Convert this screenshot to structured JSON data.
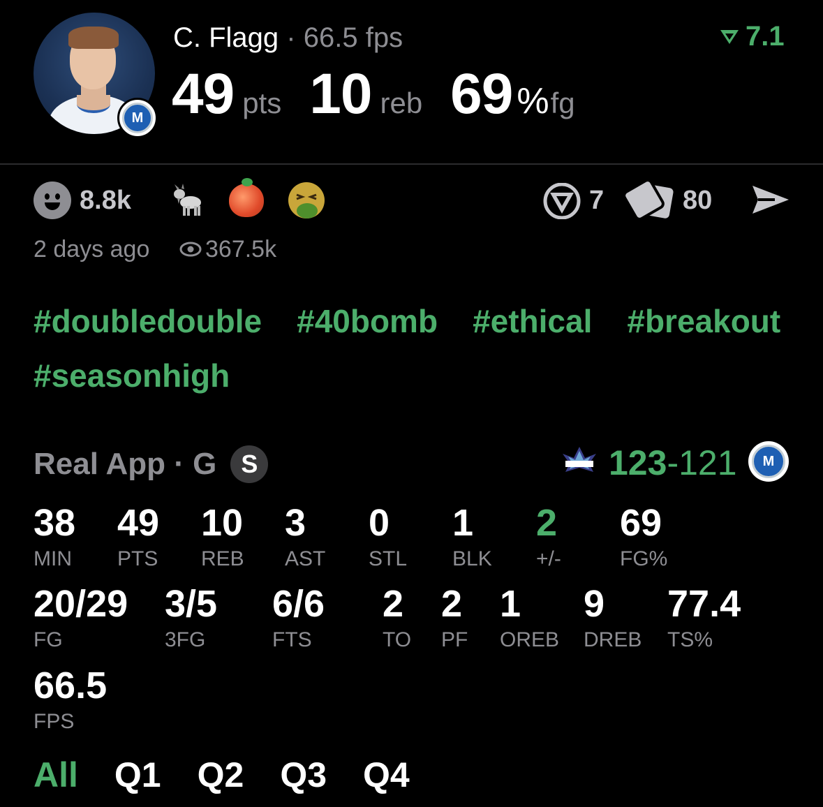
{
  "header": {
    "player_name": "C. Flagg",
    "separator": "·",
    "fps_text": "66.5 fps",
    "rating": "7.1",
    "stats": {
      "pts": "49",
      "pts_unit": "pts",
      "reb": "10",
      "reb_unit": "reb",
      "fg": "69",
      "fg_pct": "%",
      "fg_unit": "fg"
    }
  },
  "reactions": {
    "count": "8.8k",
    "v_count": "7",
    "card_count": "80",
    "time_ago": "2 days ago",
    "views": "367.5k"
  },
  "tags": [
    "#doubledouble",
    "#40bomb",
    "#ethical",
    "#breakout",
    "#seasonhigh"
  ],
  "game": {
    "app_label": "Real App · G",
    "badge": "S",
    "score_win": "123",
    "score_dash": "-",
    "score_lose": "121"
  },
  "stats_row1": [
    {
      "value": "38",
      "label": "MIN"
    },
    {
      "value": "49",
      "label": "PTS"
    },
    {
      "value": "10",
      "label": "REB"
    },
    {
      "value": "3",
      "label": "AST"
    },
    {
      "value": "0",
      "label": "STL"
    },
    {
      "value": "1",
      "label": "BLK"
    },
    {
      "value": "2",
      "label": "+/-"
    },
    {
      "value": "69",
      "label": "FG%"
    }
  ],
  "stats_row2": [
    {
      "value": "20/29",
      "label": "FG"
    },
    {
      "value": "3/5",
      "label": "3FG"
    },
    {
      "value": "6/6",
      "label": "FTS"
    },
    {
      "value": "2",
      "label": "TO"
    },
    {
      "value": "2",
      "label": "PF"
    },
    {
      "value": "1",
      "label": "OREB"
    },
    {
      "value": "9",
      "label": "DREB"
    },
    {
      "value": "77.4",
      "label": "TS%"
    }
  ],
  "stats_row3": [
    {
      "value": "66.5",
      "label": "FPS"
    }
  ],
  "quarters": [
    "All",
    "Q1",
    "Q2",
    "Q3",
    "Q4"
  ],
  "colors": {
    "accent": "#4cae6b",
    "muted": "#8e8e93",
    "background": "#000000"
  },
  "team": {
    "badge_text": "M"
  }
}
